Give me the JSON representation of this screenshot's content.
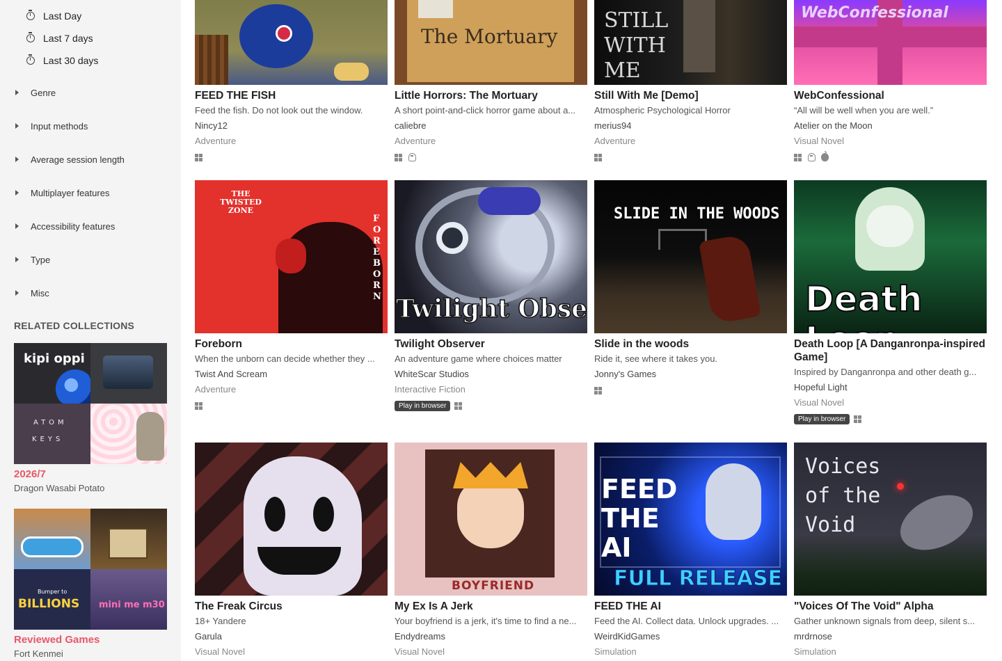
{
  "sidebar": {
    "time_filters": [
      "Last Day",
      "Last 7 days",
      "Last 30 days"
    ],
    "sections": [
      "Genre",
      "Input methods",
      "Average session length",
      "Multiplayer features",
      "Accessibility features",
      "Type",
      "Misc"
    ],
    "related_heading": "RELATED COLLECTIONS",
    "collections": [
      {
        "title": "2026/7",
        "curator": "Dragon Wasabi Potato",
        "tile_text": [
          "kipi oppi",
          "ATOM",
          "KEYS"
        ]
      },
      {
        "title": "Reviewed Games",
        "curator": "Fort Kenmei",
        "tile_text": [
          "BILLIONS",
          "mini me m30",
          "Bumper to"
        ]
      }
    ]
  },
  "games": [
    {
      "title": "FEED THE FISH",
      "desc": "Feed the fish. Do not look out the window.",
      "author": "Nincy12",
      "genre": "Adventure",
      "browser": "",
      "platforms": [
        "windows"
      ]
    },
    {
      "title": "Little Horrors: The Mortuary",
      "desc": "A short point-and-click horror game about a...",
      "author": "caliebre",
      "genre": "Adventure",
      "browser": "",
      "platforms": [
        "windows",
        "linux"
      ],
      "art_text": "The Mortuary"
    },
    {
      "title": "Still With Me [Demo]",
      "desc": "Atmospheric Psychological Horror",
      "author": "merius94",
      "genre": "Adventure",
      "browser": "",
      "platforms": [
        "windows"
      ],
      "art_text": "STILL WITH ME"
    },
    {
      "title": "WebConfessional",
      "desc": "“All will be well when you are well.”",
      "author": "Atelier on the Moon",
      "genre": "Visual Novel",
      "browser": "",
      "platforms": [
        "windows",
        "linux",
        "mac"
      ],
      "art_text": "WebConfessional"
    },
    {
      "title": "Foreborn",
      "desc": "When the unborn can decide whether they ...",
      "author": "Twist And Scream",
      "genre": "Adventure",
      "browser": "",
      "platforms": [
        "windows"
      ],
      "art_text": "THE TWISTED ZONE",
      "art_side": "FOREBORN"
    },
    {
      "title": "Twilight Observer",
      "desc": "An adventure game where choices matter",
      "author": "WhiteScar Studios",
      "genre": "Interactive Fiction",
      "browser": "Play in browser",
      "platforms": [
        "windows"
      ],
      "art_text": "Twilight Observer"
    },
    {
      "title": "Slide in the woods",
      "desc": "Ride it, see where it takes you.",
      "author": "Jonny's Games",
      "genre": "",
      "browser": "",
      "platforms": [
        "windows"
      ],
      "art_text": "SLIDE IN THE WOODS"
    },
    {
      "title": "Death Loop [A Danganronpa-inspired Game]",
      "desc": "Inspired by Danganronpa and other death g...",
      "author": "Hopeful Light",
      "genre": "Visual Novel",
      "browser": "Play in browser",
      "platforms": [
        "windows"
      ],
      "art_text": "Death Loop"
    },
    {
      "title": "The Freak Circus",
      "desc": "18+ Yandere",
      "author": "Garula",
      "genre": "Visual Novel",
      "browser": "",
      "platforms": []
    },
    {
      "title": "My Ex Is A Jerk",
      "desc": "Your boyfriend is a jerk, it's time to find a ne...",
      "author": "Endydreams",
      "genre": "Visual Novel",
      "browser": "",
      "platforms": [],
      "art_text": "BOYFRIEND"
    },
    {
      "title": "FEED THE AI",
      "desc": "Feed the AI. Collect data. Unlock upgrades. ...",
      "author": "WeirdKidGames",
      "genre": "Simulation",
      "browser": "",
      "platforms": [],
      "art_text": "FEED THE AI",
      "art_sub": "FULL RELEASE"
    },
    {
      "title": "\"Voices Of The Void\" Alpha",
      "desc": "Gather unknown signals from deep, silent s...",
      "author": "mrdrnose",
      "genre": "Simulation",
      "browser": "",
      "platforms": [],
      "art_text": "Voices of the Void"
    }
  ],
  "colors": {
    "sidebar_bg": "#f4f4f4",
    "collection_title": "#e75867",
    "badge_bg": "#444444"
  }
}
